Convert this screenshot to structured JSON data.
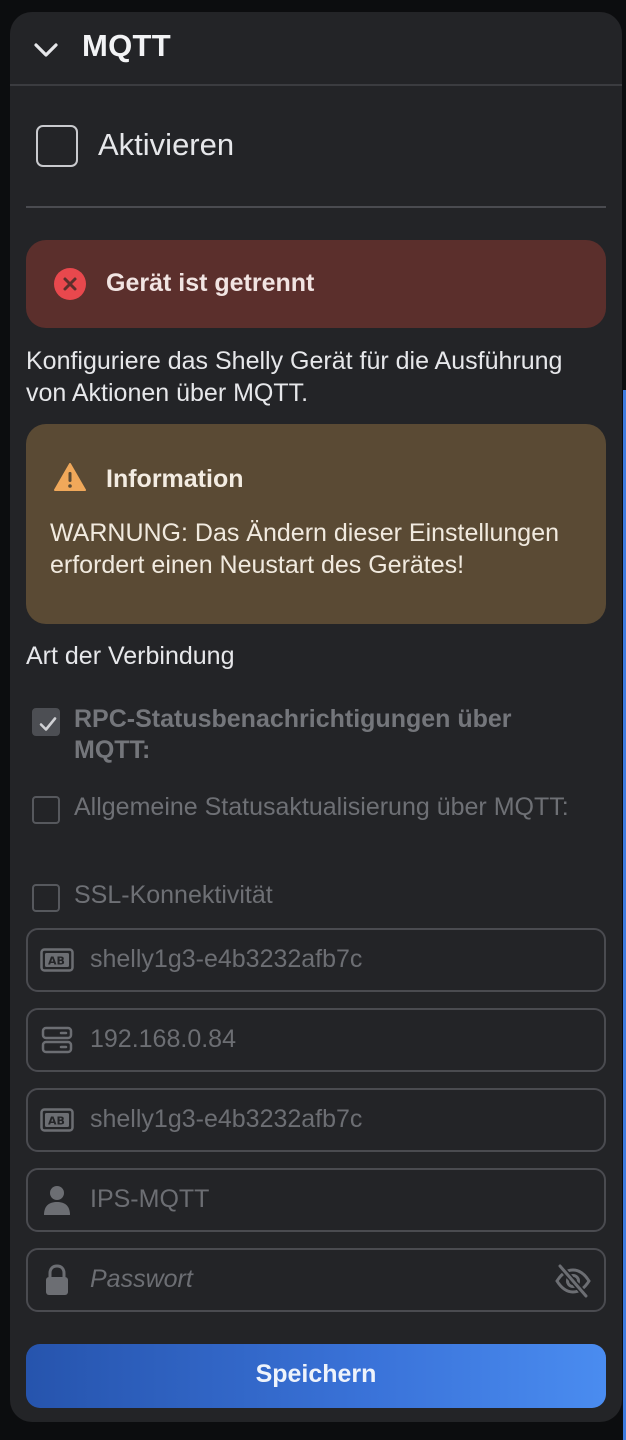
{
  "header": {
    "title": "MQTT"
  },
  "activate": {
    "label": "Aktivieren",
    "checked": false
  },
  "error_alert": {
    "text": "Gerät ist getrennt"
  },
  "description": "Konfiguriere das Shelly Gerät für die Ausführung von Aktionen über MQTT.",
  "info_alert": {
    "title": "Information",
    "body": "WARNUNG: Das Ändern dieser Einstellungen erfordert einen Neustart des Gerätes!"
  },
  "connection": {
    "label": "Art der Verbindung",
    "options": [
      {
        "label": "RPC-Statusbenachrichtigungen über MQTT:",
        "checked": true
      },
      {
        "label": "Allgemeine Statusaktualisierung über MQTT:",
        "checked": false
      },
      {
        "label": "SSL-Konnektivität",
        "checked": false
      }
    ]
  },
  "fields": {
    "client_id": {
      "value": "shelly1g3-e4b3232afb7c",
      "icon": "ab-text-icon"
    },
    "server": {
      "value": "192.168.0.84",
      "icon": "server-icon"
    },
    "topic_prefix": {
      "value": "shelly1g3-e4b3232afb7c",
      "icon": "ab-text-icon"
    },
    "username": {
      "value": "IPS-MQTT",
      "icon": "user-icon"
    },
    "password": {
      "placeholder": "Passwort",
      "icon": "lock-icon"
    }
  },
  "save_button": {
    "label": "Speichern"
  },
  "colors": {
    "panel": "#232427",
    "error_bg": "#5b2f2c",
    "error_icon": "#e8484d",
    "info_bg": "#5a4a34",
    "warning_icon": "#f0a85a",
    "accent": "#3a73d9"
  }
}
